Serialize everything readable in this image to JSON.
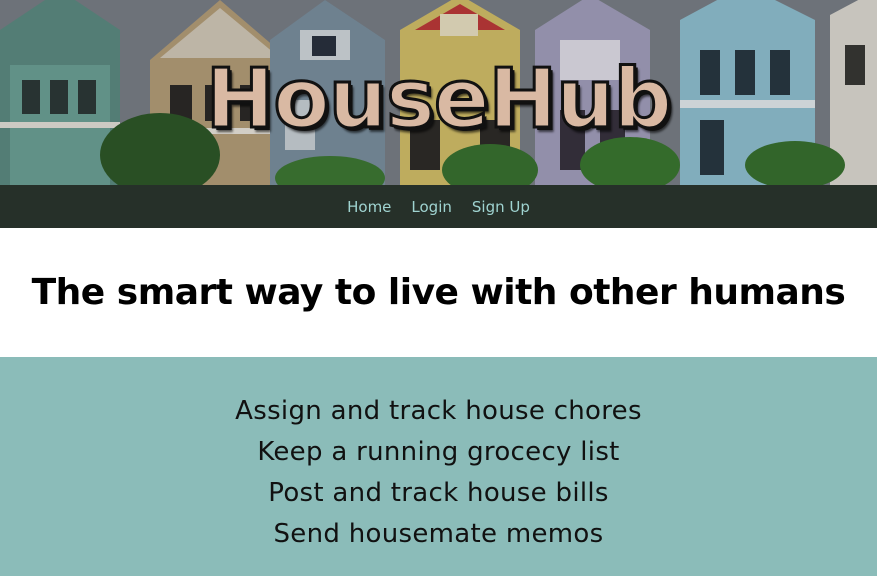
{
  "hero": {
    "title": "HouseHub"
  },
  "nav": {
    "items": [
      {
        "label": "Home"
      },
      {
        "label": "Login"
      },
      {
        "label": "Sign Up"
      }
    ]
  },
  "tagline": "The smart way to live with other humans",
  "features": [
    "Assign and track house chores",
    "Keep a running grocecy list",
    "Post and track house bills",
    "Send housemate memos"
  ],
  "colors": {
    "nav_bg": "#263029",
    "nav_link": "#9fd3d0",
    "features_bg": "#8bbcb9",
    "title_fill": "#d9b9a3"
  }
}
